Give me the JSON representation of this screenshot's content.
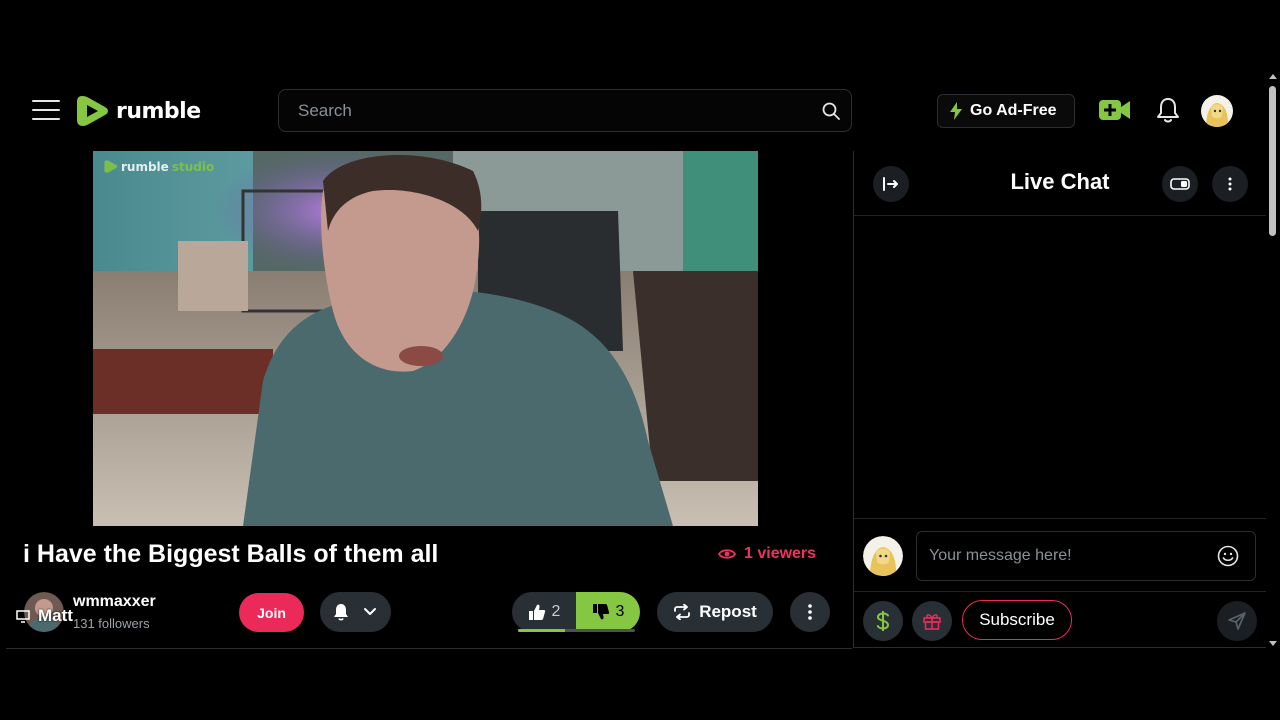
{
  "header": {
    "logo_text": "rumble",
    "search_placeholder": "Search",
    "ad_free_label": "Go Ad-Free",
    "icons": [
      "menu-icon",
      "search-icon",
      "lightning-icon",
      "go-live-icon",
      "bell-icon",
      "avatar"
    ]
  },
  "video": {
    "watermark_brand": "rumble",
    "watermark_suffix": "studio",
    "title": "i Have the Biggest Balls of them all",
    "viewers_label": "1 viewers"
  },
  "channel": {
    "overlay_name": "Matt",
    "name": "wmmaxxer",
    "followers": "131 followers",
    "join_label": "Join"
  },
  "actions": {
    "likes": "2",
    "dislikes": "3",
    "like_ratio": 0.4,
    "repost_label": "Repost"
  },
  "chat": {
    "title": "Live Chat",
    "input_placeholder": "Your message here!",
    "subscribe_label": "Subscribe"
  },
  "colors": {
    "brand_green": "#85c742",
    "accent_pink": "#ec2a5a",
    "viewers_red": "#f23160",
    "button_bg": "#283036"
  }
}
